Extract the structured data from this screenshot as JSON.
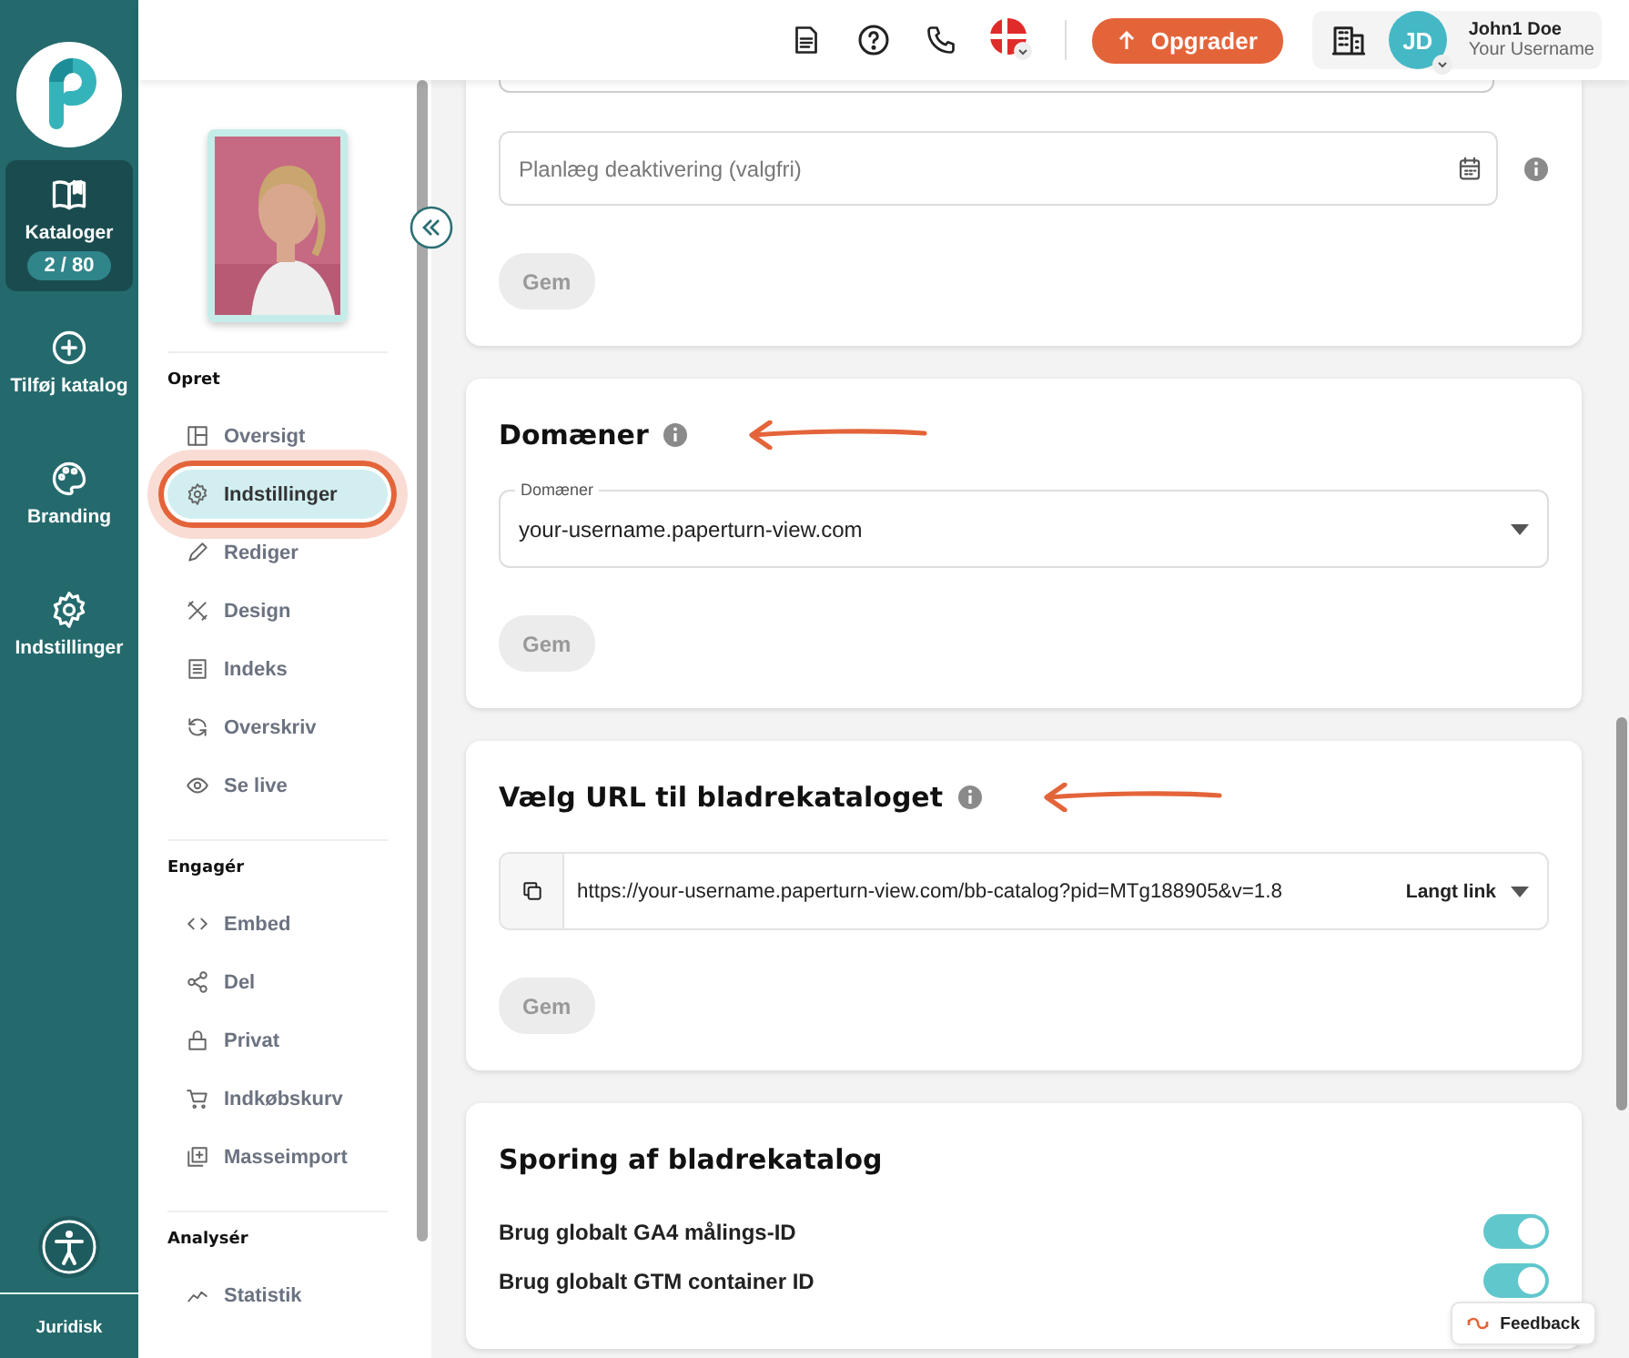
{
  "rail": {
    "items": [
      {
        "label": "Kataloger",
        "badge": "2 / 80",
        "selected": true
      },
      {
        "label": "Tilføj katalog",
        "selected": false
      },
      {
        "label": "Branding",
        "selected": false
      },
      {
        "label": "Indstillinger",
        "selected": false
      }
    ],
    "footer": "Juridisk"
  },
  "header": {
    "upgrade_button": "Opgrader",
    "user": {
      "initials": "JD",
      "name": "John1 Doe",
      "username": "Your Username"
    }
  },
  "sidebar": {
    "sections": [
      {
        "title": "Opret",
        "items": [
          {
            "label": "Oversigt",
            "selected": false,
            "highlighted": false
          },
          {
            "label": "Indstillinger",
            "selected": true,
            "highlighted": true
          },
          {
            "label": "Rediger",
            "selected": false,
            "highlighted": false
          },
          {
            "label": "Design",
            "selected": false,
            "highlighted": false
          },
          {
            "label": "Indeks",
            "selected": false,
            "highlighted": false
          },
          {
            "label": "Overskriv",
            "selected": false,
            "highlighted": false
          },
          {
            "label": "Se live",
            "selected": false,
            "highlighted": false
          }
        ]
      },
      {
        "title": "Engagér",
        "items": [
          {
            "label": "Embed",
            "selected": false,
            "highlighted": false
          },
          {
            "label": "Del",
            "selected": false,
            "highlighted": false
          },
          {
            "label": "Privat",
            "selected": false,
            "highlighted": false
          },
          {
            "label": "Indkøbskurv",
            "selected": false,
            "highlighted": false
          },
          {
            "label": "Masseimport",
            "selected": false,
            "highlighted": false
          }
        ]
      },
      {
        "title": "Analysér",
        "items": [
          {
            "label": "Statistik",
            "selected": false,
            "highlighted": false
          }
        ]
      }
    ]
  },
  "cards": [
    {
      "kind": "schedule",
      "field": {
        "placeholder": "Planlæg deaktivering (valgfri)"
      },
      "button": {
        "label": "Gem",
        "disabled": true
      }
    },
    {
      "kind": "select",
      "title": "Domæner",
      "info": true,
      "annotated": true,
      "select": {
        "label": "Domæner",
        "value": "your-username.paperturn-view.com"
      },
      "button": {
        "label": "Gem",
        "disabled": true
      }
    },
    {
      "kind": "url",
      "title": "Vælg URL til bladrekataloget",
      "info": true,
      "annotated": true,
      "url": {
        "value": "https://your-username.paperturn-view.com/bb-catalog?pid=MTg188905&v=1.8",
        "option": "Langt link"
      },
      "button": {
        "label": "Gem",
        "disabled": true
      }
    },
    {
      "kind": "toggles",
      "title": "Sporing af bladrekatalog",
      "info": false,
      "annotated": false,
      "toggles": [
        {
          "label": "Brug globalt GA4 målings-ID",
          "on": true
        },
        {
          "label": "Brug globalt GTM container ID",
          "on": true
        }
      ]
    }
  ],
  "feedback_button": "Feedback"
}
